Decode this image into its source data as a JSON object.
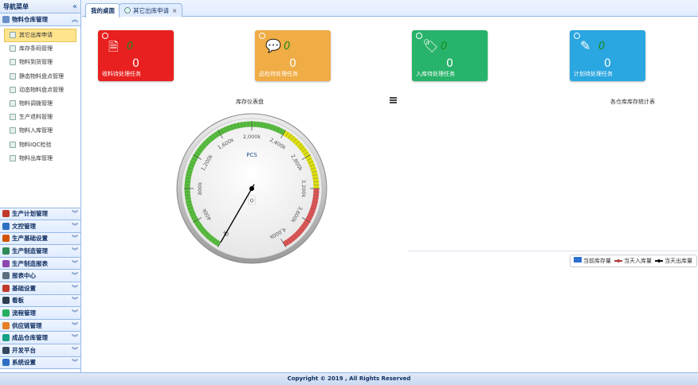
{
  "sidebar": {
    "title": "导航菜单",
    "collapse_icon": "double-chevron-left-icon",
    "open_section": {
      "label": "物料仓库管理",
      "items": [
        {
          "label": "其它出库申请",
          "active": true,
          "icon": "doc-icon"
        },
        {
          "label": "库存条码管理",
          "icon": "barcode-icon"
        },
        {
          "label": "物料到货管理",
          "icon": "truck-icon"
        },
        {
          "label": "静态物料盘点管理",
          "icon": "search-icon"
        },
        {
          "label": "动态物料盘点管理",
          "icon": "search-icon"
        },
        {
          "label": "物料调拨管理",
          "icon": "transfer-icon"
        },
        {
          "label": "生产退料管理",
          "icon": "return-icon"
        },
        {
          "label": "物料入库管理",
          "icon": "inbound-icon"
        },
        {
          "label": "物料IQC检验",
          "icon": "user-icon"
        },
        {
          "label": "物料出库管理",
          "icon": "outbound-icon"
        }
      ]
    },
    "sections": [
      {
        "label": "生产计划管理",
        "color": "#c0392b"
      },
      {
        "label": "文控管理",
        "color": "#2e6fc4"
      },
      {
        "label": "生产基础设置",
        "color": "#d35400"
      },
      {
        "label": "生产制造管理",
        "color": "#2e8b57"
      },
      {
        "label": "生产制造报表",
        "color": "#8e44ad"
      },
      {
        "label": "报表中心",
        "color": "#5d6d7e"
      },
      {
        "label": "基础设置",
        "color": "#c0392b"
      },
      {
        "label": "看板",
        "color": "#2c3e50"
      },
      {
        "label": "流程管理",
        "color": "#27ae60"
      },
      {
        "label": "供应链管理",
        "color": "#e67e22"
      },
      {
        "label": "成品仓库管理",
        "color": "#16a085"
      },
      {
        "label": "开发平台",
        "color": "#34495e"
      },
      {
        "label": "系统设置",
        "color": "#2e6fc4"
      }
    ]
  },
  "tabs": [
    {
      "label": "我的桌面",
      "selected": true
    },
    {
      "label": "其它出库申请",
      "close": "×"
    }
  ],
  "cards": [
    {
      "label": "收料待处理任务",
      "count": "0",
      "italic_count": "0",
      "color": "#e8201f",
      "icon": "document-check-icon"
    },
    {
      "label": "品检待处理任务",
      "count": "0",
      "italic_count": "0",
      "color": "#f0ac45",
      "icon": "chat-bubble-icon"
    },
    {
      "label": "入库待处理任务",
      "count": "0",
      "italic_count": "0",
      "color": "#28b36a",
      "icon": "tag-icon"
    },
    {
      "label": "计划待处理任务",
      "count": "0",
      "italic_count": "0",
      "color": "#2aa6e0",
      "icon": "pencil-icon"
    }
  ],
  "gauge_panel": {
    "title": "库存仪表盘",
    "menu_icon": "hamburger-menu-icon"
  },
  "chart_data": {
    "type": "gauge",
    "title": "库存仪表盘",
    "unit": "PCS",
    "min": 0,
    "max": 4000,
    "value": 0,
    "value_label": "0",
    "tick_labels": [
      "0k",
      "400k",
      "800k",
      "1,200k",
      "1,600k",
      "2,000k",
      "2,400k",
      "2,800k",
      "3,200k",
      "3,600k",
      "4,000k"
    ],
    "ticks": [
      0,
      400,
      800,
      1200,
      1600,
      2000,
      2400,
      2800,
      3200,
      3600,
      4000
    ],
    "bands": [
      {
        "from": 0,
        "to": 2400,
        "color": "#55bf3b"
      },
      {
        "from": 2400,
        "to": 3200,
        "color": "#dddf0d"
      },
      {
        "from": 3200,
        "to": 4000,
        "color": "#df5353"
      }
    ]
  },
  "stats_panel": {
    "title": "各仓库库存统计表",
    "legend": [
      {
        "label": "当前库存量",
        "color": "#2f6fd0",
        "kind": "bar"
      },
      {
        "label": "当天入库量",
        "color": "#b04040",
        "kind": "line"
      },
      {
        "label": "当天出库量",
        "color": "#111111",
        "kind": "line"
      }
    ]
  },
  "footer": {
    "copyright": "Copyright © 2019 , All Rights Reserved"
  }
}
